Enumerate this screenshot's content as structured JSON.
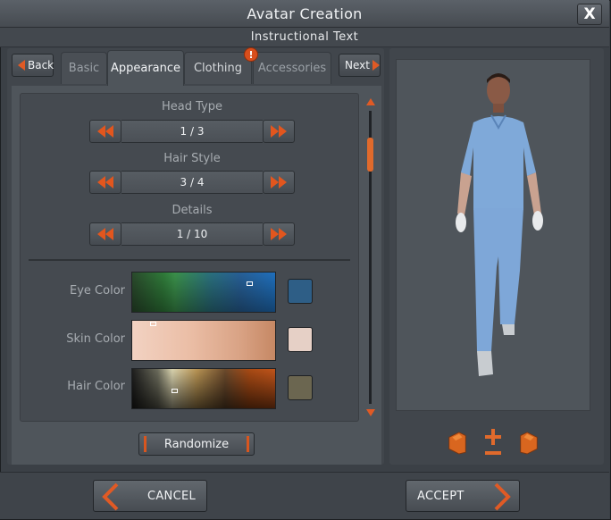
{
  "window": {
    "title": "Avatar Creation",
    "instruction": "Instructional Text",
    "close_label": "X"
  },
  "tabs": {
    "back_label": "Back",
    "next_label": "Next",
    "items": [
      {
        "label": "Basic",
        "state": "inactive"
      },
      {
        "label": "Appearance",
        "state": "active"
      },
      {
        "label": "Clothing",
        "state": "alert"
      },
      {
        "label": "Accessories",
        "state": "inactive"
      }
    ],
    "alert_glyph": "!"
  },
  "selectors": [
    {
      "label": "Head Type",
      "value": "1 / 3"
    },
    {
      "label": "Hair Style",
      "value": "3 / 4"
    },
    {
      "label": "Details",
      "value": "1 / 10"
    }
  ],
  "colors": {
    "eye": {
      "label": "Eye Color",
      "swatch": "#2e5e86"
    },
    "skin": {
      "label": "Skin Color",
      "swatch": "#e6d0c6"
    },
    "hair": {
      "label": "Hair Color",
      "swatch": "#6b6650"
    }
  },
  "randomize_label": "Randomize",
  "footer": {
    "cancel_label": "CANCEL",
    "accept_label": "ACCEPT"
  },
  "icons": {
    "accent": "#e05a25",
    "rotate_left": "rotate-left-icon",
    "zoom": "zoom-icon",
    "rotate_right": "rotate-right-icon"
  }
}
